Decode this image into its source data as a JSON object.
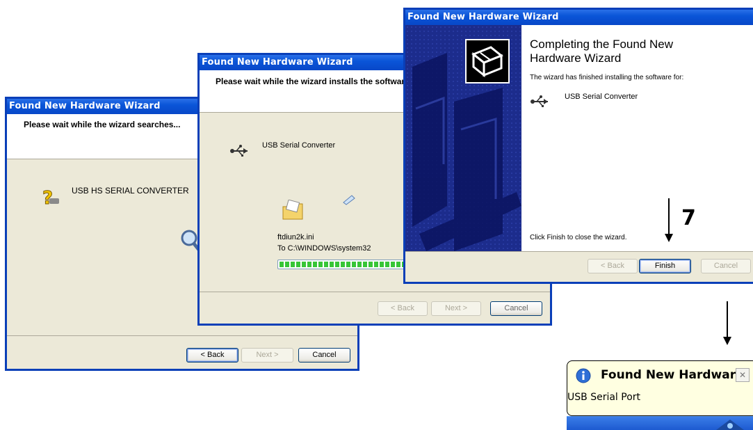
{
  "window1": {
    "title": "Found New Hardware Wizard",
    "header": "Please wait while the wizard searches...",
    "device": "USB HS SERIAL CONVERTER",
    "back_label": "< Back",
    "next_label": "Next >",
    "cancel_label": "Cancel"
  },
  "window2": {
    "title": "Found New Hardware Wizard",
    "header": "Please wait while the wizard installs the softwar",
    "device": "USB Serial Converter",
    "file_name": "ftdiun2k.ini",
    "file_dest": "To C:\\WINDOWS\\system32",
    "progress": 1.0,
    "back_label": "< Back",
    "next_label": "Next >",
    "cancel_label": "Cancel"
  },
  "window3": {
    "title": "Found New Hardware Wizard",
    "heading_line1": "Completing the Found New",
    "heading_line2": "Hardware Wizard",
    "info": "The wizard has finished installing the software for:",
    "device": "USB Serial Converter",
    "close_hint": "Click Finish to close the wizard.",
    "back_label": "< Back",
    "finish_label": "Finish",
    "cancel_label": "Cancel"
  },
  "step_label": "7",
  "balloon": {
    "title": "Found New Hardware",
    "message": "USB Serial Port",
    "close_label": "✕"
  }
}
